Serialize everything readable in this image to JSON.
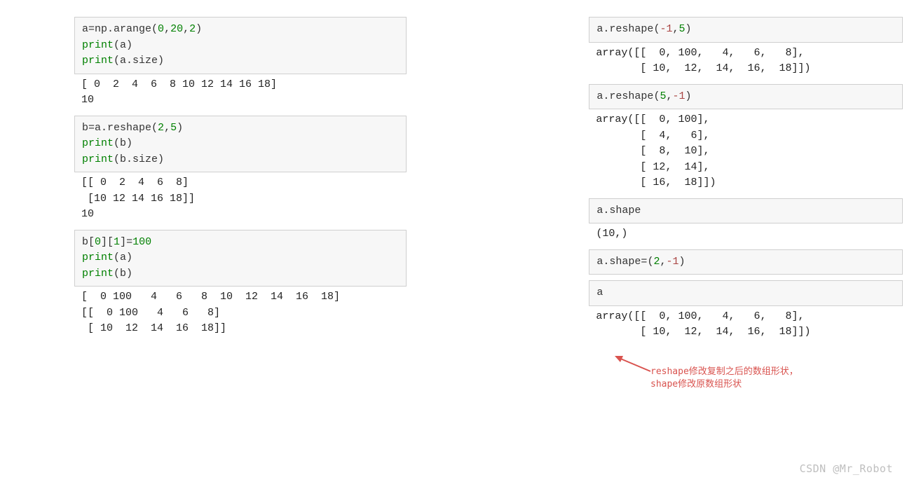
{
  "left": {
    "block1": {
      "l1_a": "a=np.arange",
      "l1_args_open": "(",
      "l1_n1": "0",
      "l1_c1": ",",
      "l1_n2": "20",
      "l1_c2": ",",
      "l1_n3": "2",
      "l1_close": ")",
      "l2": "print",
      "l2_arg": "(a)",
      "l3": "print",
      "l3_arg": "(a.size)"
    },
    "out1": "[ 0  2  4  6  8 10 12 14 16 18]\n10",
    "block2": {
      "l1": "b=a.reshape",
      "l1_open": "(",
      "l1_n1": "2",
      "l1_c": ",",
      "l1_n2": "5",
      "l1_close": ")",
      "l2": "print",
      "l2_arg": "(b)",
      "l3": "print",
      "l3_arg": "(b.size)"
    },
    "out2": "[[ 0  2  4  6  8]\n [10 12 14 16 18]]\n10",
    "block3": {
      "l1a": "b[",
      "l1n1": "0",
      "l1b": "][",
      "l1n2": "1",
      "l1c": "]=",
      "l1n3": "100",
      "l2": "print",
      "l2_arg": "(a)",
      "l3": "print",
      "l3_arg": "(b)"
    },
    "out3": "[  0 100   4   6   8  10  12  14  16  18]\n[[  0 100   4   6   8]\n [ 10  12  14  16  18]]"
  },
  "right": {
    "block1": {
      "l1": "a.reshape",
      "open": "(",
      "n1": "-1",
      "c": ",",
      "n2": "5",
      "close": ")"
    },
    "out1": "array([[  0, 100,   4,   6,   8],\n       [ 10,  12,  14,  16,  18]])",
    "block2": {
      "l1": "a.reshape",
      "open": "(",
      "n1": "5",
      "c": ",",
      "n2": "-1",
      "close": ")"
    },
    "out2": "array([[  0, 100],\n       [  4,   6],\n       [  8,  10],\n       [ 12,  14],\n       [ 16,  18]])",
    "block3": {
      "l1": "a.shape"
    },
    "out3": "(10,)",
    "block4": {
      "l1": "a.shape=",
      "open": "(",
      "n1": "2",
      "c": ",",
      "n2": "-1",
      "close": ")"
    },
    "block5": {
      "l1": "a"
    },
    "out5": "array([[  0, 100,   4,   6,   8],\n       [ 10,  12,  14,  16,  18]])"
  },
  "annotation": {
    "line1": "reshape修改复制之后的数组形状，",
    "line2": "shape修改原数组形状"
  },
  "watermark": "CSDN @Mr_Robot"
}
